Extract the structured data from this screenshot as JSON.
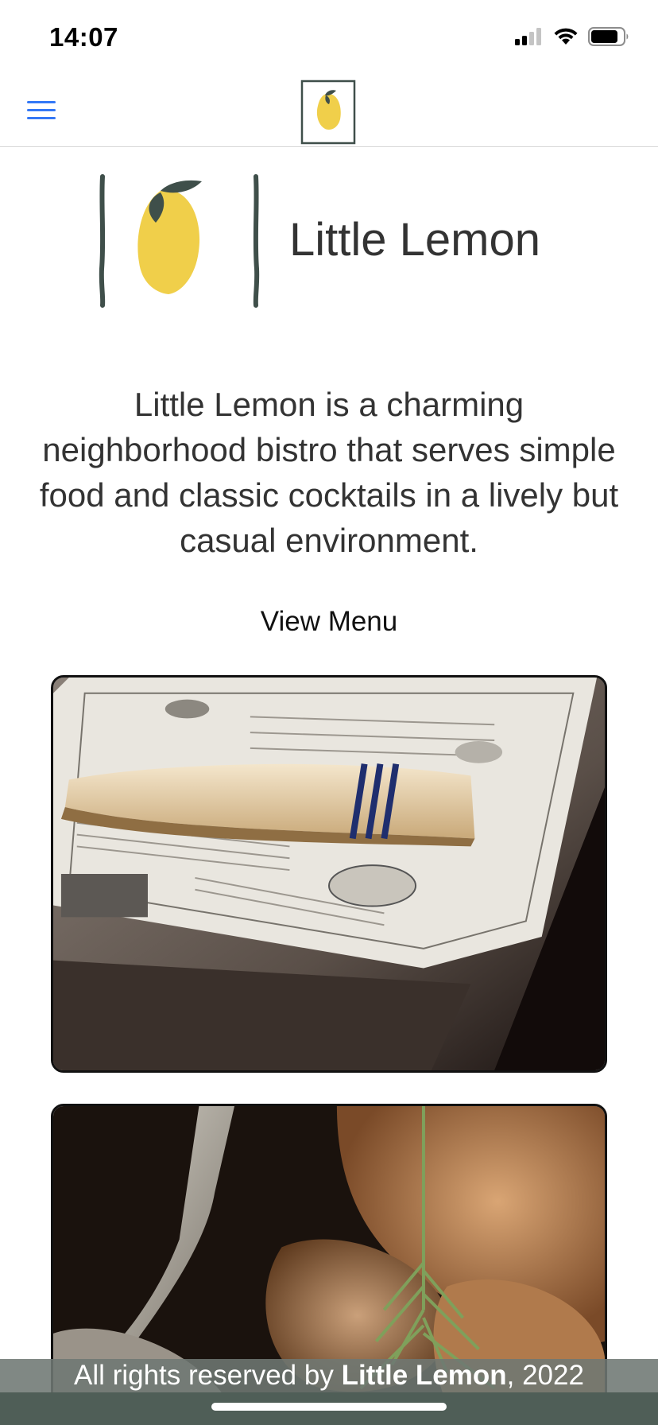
{
  "status_bar": {
    "time": "14:07",
    "icons": [
      "cellular-signal-icon",
      "wifi-icon",
      "battery-icon"
    ]
  },
  "header": {
    "menu_icon": "hamburger-menu-icon",
    "logo_icon": "little-lemon-logo-icon"
  },
  "brand": {
    "title": "Little Lemon",
    "logo_icon": "lemon-logo-icon"
  },
  "description": "Little Lemon is a charming neighborhood bistro that serves simple food and classic cocktails in a lively but casual environment.",
  "view_menu_label": "View Menu",
  "images": [
    {
      "name": "table-setting-photo"
    },
    {
      "name": "food-dish-photo"
    }
  ],
  "footer": {
    "prefix": "All rights reserved by ",
    "brand": "Little Lemon",
    "suffix": ", 2022"
  },
  "colors": {
    "accent_blue": "#3478f6",
    "lemon_yellow": "#f0cf4a",
    "leaf_dark_green": "#3f4f4a",
    "footer_green": "#4f5e57"
  }
}
